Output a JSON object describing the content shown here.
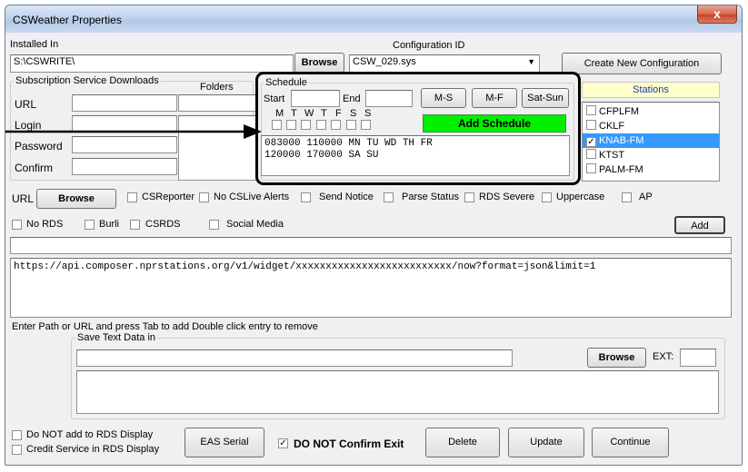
{
  "window": {
    "title": "CSWeather Properties",
    "close_glyph": "x"
  },
  "installed": {
    "label": "Installed In",
    "value": "S:\\CSWRITE\\",
    "browse": "Browse"
  },
  "config": {
    "label": "Configuration ID",
    "value": "CSW_029.sys",
    "create_button": "Create New Configuration"
  },
  "subscription": {
    "legend": "Subscription Service Downloads",
    "url": "URL",
    "login": "Login",
    "password": "Password",
    "confirm": "Confirm",
    "folders": "Folders"
  },
  "schedule": {
    "legend": "Schedule",
    "start": "Start",
    "end": "End",
    "ms": "M-S",
    "mf": "M-F",
    "satsun": "Sat-Sun",
    "days": [
      "M",
      "T",
      "W",
      "T",
      "F",
      "S",
      "S"
    ],
    "add": "Add Schedule",
    "lines": [
      "083000 110000 MN TU WD TH FR",
      "120000 170000 SA SU"
    ]
  },
  "stations": {
    "header": "Stations",
    "items": [
      {
        "name": "CFPLFM",
        "checked": false,
        "selected": false
      },
      {
        "name": "CKLF",
        "checked": false,
        "selected": false
      },
      {
        "name": "KNAB-FM",
        "checked": true,
        "selected": true
      },
      {
        "name": "KTST",
        "checked": false,
        "selected": false
      },
      {
        "name": "PALM-FM",
        "checked": false,
        "selected": false
      }
    ]
  },
  "row_url": {
    "url": "URL",
    "browse": "Browse",
    "csreporter": "CSReporter",
    "no_cslive": "No CSLive Alerts",
    "send_notice": "Send Notice",
    "parse_status": "Parse Status",
    "rds_severe": "RDS Severe",
    "uppercase": "Uppercase",
    "ap": "AP"
  },
  "row_rds": {
    "no_rds": "No RDS",
    "burli": "Burli",
    "csrds": "CSRDS",
    "social": "Social Media",
    "add": "Add"
  },
  "url_list": {
    "entry": "https://api.composer.nprstations.org/v1/widget/xxxxxxxxxxxxxxxxxxxxxxxxxx/now?format=json&limit=1"
  },
  "hint": "Enter Path or URL and  press Tab to add Double click entry  to remove",
  "save": {
    "legend": "Save Text Data in",
    "browse": "Browse",
    "ext": "EXT:"
  },
  "bottom": {
    "no_add_rds": "Do NOT add to RDS Display",
    "credit": "Credit Service in RDS Display",
    "eas": "EAS Serial",
    "no_confirm": "DO NOT Confirm Exit",
    "delete": "Delete",
    "update": "Update",
    "continue": "Continue"
  }
}
